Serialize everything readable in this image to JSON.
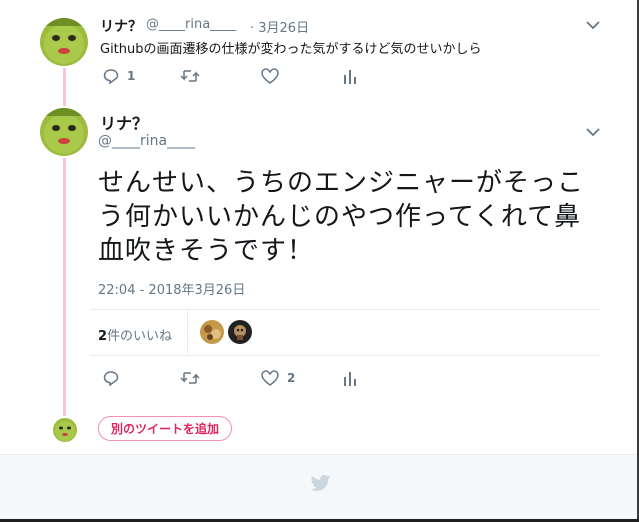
{
  "tweet1": {
    "name": "リナ？",
    "handle": "@____rina____",
    "date": "· 3月26日",
    "text": "Githubの画面遷移の仕様が変わった気がするけど気のせいかしら",
    "reply_count": "1"
  },
  "tweet2": {
    "name": "リナ？",
    "handle": "@____rina____",
    "text": "せんせい、うちのエンジニャーがそっこう何かいいかんじのやつ作ってくれて鼻血吹きそうです！",
    "timestamp": "22:04 - 2018年3月26日",
    "likes_number": "2",
    "likes_suffix": "件のいいね",
    "like_count": "2"
  },
  "add_tweet_label": "別のツイートを追加",
  "colors": {
    "thread_line": "#f7c4d9",
    "accent": "#e0245e",
    "muted": "#657786",
    "footer_bg": "#f5f8fa"
  },
  "icons": [
    "reply-icon",
    "retweet-icon",
    "like-icon",
    "analytics-icon",
    "chevron-down-icon",
    "twitter-bird-icon"
  ]
}
